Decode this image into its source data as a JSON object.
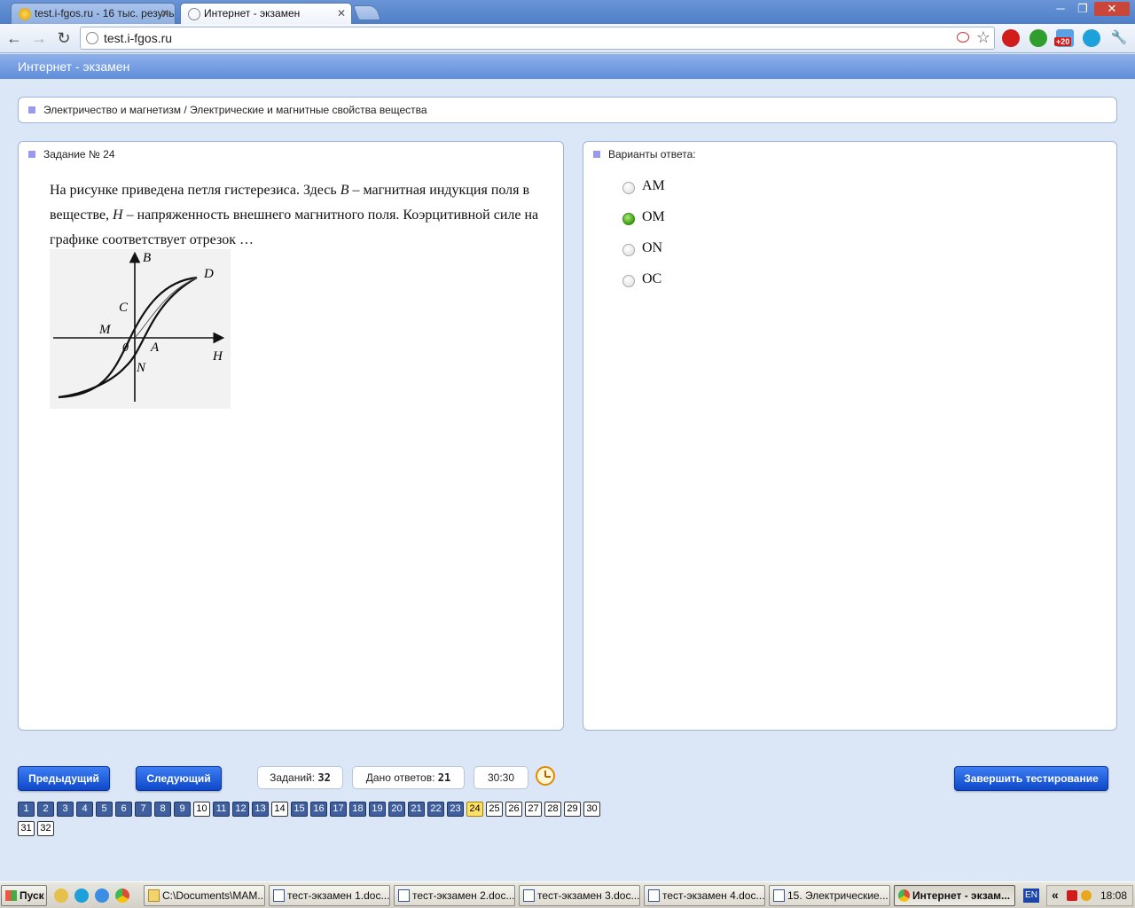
{
  "browser": {
    "tabs": [
      {
        "title": "test.i-fgos.ru - 16 тыс. резуль",
        "active": false
      },
      {
        "title": "Интернет - экзамен",
        "active": true
      }
    ],
    "url": "test.i-fgos.ru",
    "window_buttons": {
      "minimize": "─",
      "restore": "❐",
      "close": "✕"
    },
    "nav": {
      "back": "←",
      "forward": "→",
      "reload": "↻"
    },
    "star": "☆",
    "wrench": "🔧",
    "extensions": [
      {
        "name": "adblock-icon",
        "color": "#d11c1c"
      },
      {
        "name": "utorrent-icon",
        "color": "#2f9e2f"
      },
      {
        "name": "mail-notifier-icon",
        "color": "#5aa0e6",
        "badge": "+20"
      },
      {
        "name": "skype-icon",
        "color": "#1ea0d8"
      }
    ]
  },
  "app": {
    "title": "Интернет - экзамен",
    "breadcrumb": "Электричество и магнетизм / Электрические и магнитные свойства вещества",
    "task_label": "Задание № 24",
    "question": {
      "part1": "На рисунке приведена петля гистерезиса. Здесь ",
      "var_b": "B",
      "part2": " – магнитная индукция поля в веществе, ",
      "var_h": "H",
      "part3": " – напряженность внешнего магнитного поля. Коэрцитивной силе на графике соответствует отрезок …"
    },
    "figure_labels": {
      "b": "B",
      "h": "H",
      "d": "D",
      "c": "C",
      "m": "M",
      "o": "0",
      "a": "A",
      "n": "N"
    },
    "answers_label": "Варианты ответа:",
    "answers": [
      {
        "label": "AM",
        "selected": false
      },
      {
        "label": "OM",
        "selected": true
      },
      {
        "label": "ON",
        "selected": false
      },
      {
        "label": "OC",
        "selected": false
      }
    ],
    "buttons": {
      "prev": "Предыдущий",
      "next": "Следующий",
      "finish": "Завершить тестирование"
    },
    "counters": {
      "tasks_label": "Заданий: ",
      "tasks_value": "32",
      "answered_label": "Дано ответов: ",
      "answered_value": "21",
      "timer": "30:30"
    },
    "pages": [
      {
        "n": "1",
        "state": "answered"
      },
      {
        "n": "2",
        "state": "answered"
      },
      {
        "n": "3",
        "state": "answered"
      },
      {
        "n": "4",
        "state": "answered"
      },
      {
        "n": "5",
        "state": "answered"
      },
      {
        "n": "6",
        "state": "answered"
      },
      {
        "n": "7",
        "state": "answered"
      },
      {
        "n": "8",
        "state": "answered"
      },
      {
        "n": "9",
        "state": "answered"
      },
      {
        "n": "10",
        "state": "empty"
      },
      {
        "n": "11",
        "state": "answered"
      },
      {
        "n": "12",
        "state": "answered"
      },
      {
        "n": "13",
        "state": "answered"
      },
      {
        "n": "14",
        "state": "empty"
      },
      {
        "n": "15",
        "state": "answered"
      },
      {
        "n": "16",
        "state": "answered"
      },
      {
        "n": "17",
        "state": "answered"
      },
      {
        "n": "18",
        "state": "answered"
      },
      {
        "n": "19",
        "state": "answered"
      },
      {
        "n": "20",
        "state": "answered"
      },
      {
        "n": "21",
        "state": "answered"
      },
      {
        "n": "22",
        "state": "answered"
      },
      {
        "n": "23",
        "state": "answered"
      },
      {
        "n": "24",
        "state": "current"
      },
      {
        "n": "25",
        "state": "empty"
      },
      {
        "n": "26",
        "state": "empty"
      },
      {
        "n": "27",
        "state": "empty"
      },
      {
        "n": "28",
        "state": "empty"
      },
      {
        "n": "29",
        "state": "empty"
      },
      {
        "n": "30",
        "state": "empty"
      },
      {
        "n": "31",
        "state": "empty"
      },
      {
        "n": "32",
        "state": "empty"
      }
    ]
  },
  "taskbar": {
    "start": "Пуск",
    "tasks": [
      {
        "label": "C:\\Documents\\MAM...",
        "active": false
      },
      {
        "label": "тест-экзамен 1.doc...",
        "active": false
      },
      {
        "label": "тест-экзамен 2.doc...",
        "active": false
      },
      {
        "label": "тест-экзамен 3.doc...",
        "active": false
      },
      {
        "label": "тест-экзамен 4.doc...",
        "active": false
      },
      {
        "label": "15. Электрические...",
        "active": false
      },
      {
        "label": "Интернет - экзам...",
        "active": true
      }
    ],
    "lang": "EN",
    "tray_arrows": "«",
    "time": "18:08"
  }
}
